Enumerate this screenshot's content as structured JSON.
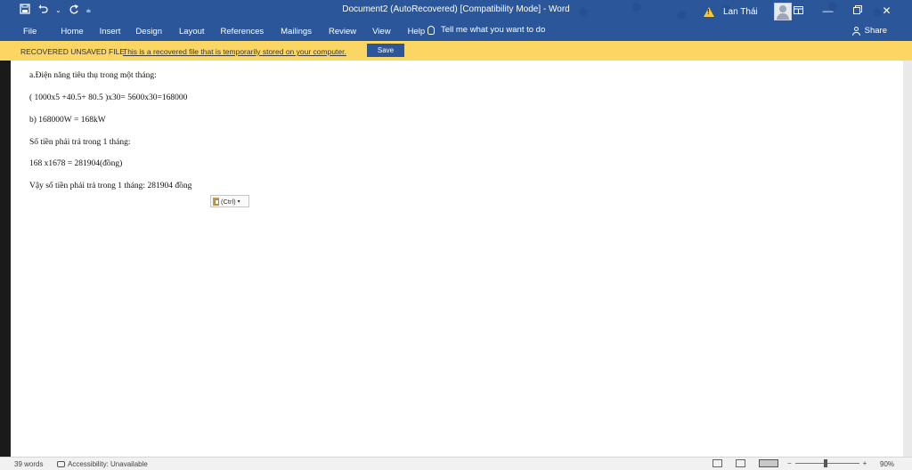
{
  "window": {
    "title": "Document2 (AutoRecovered) [Compatibility Mode] - Word",
    "user_name": "Lan Thái"
  },
  "quick_access": {
    "save_icon": "save-icon",
    "undo_icon": "undo-icon",
    "redo_icon": "redo-icon",
    "customize_icon": "customize-icon"
  },
  "ribbon": {
    "tabs": [
      "File",
      "Home",
      "Insert",
      "Design",
      "Layout",
      "References",
      "Mailings",
      "Review",
      "View",
      "Help"
    ],
    "tell_me": "Tell me what you want to do",
    "share": "Share"
  },
  "infobar": {
    "label": "RECOVERED UNSAVED FILE",
    "message": "This is a recovered file that is temporarily stored on your computer.",
    "save_label": "Save"
  },
  "document": {
    "paragraphs": [
      "a.Điện năng tiêu thụ trong một tháng:",
      "( 1000x5 +40.5+ 80.5 )x30= 5600x30=168000",
      "b) 168000W = 168kW",
      "Số tiền phải trả trong 1 tháng:",
      "168 x1678 = 281904(đồng)",
      "Vậy số tiền phải trả trong 1 tháng: 281904 đồng"
    ],
    "paste_options": "(Ctrl)"
  },
  "status": {
    "words": "39 words",
    "accessibility": "Accessibility: Unavailable",
    "zoom": "90%"
  },
  "colors": {
    "titlebar": "#2b579a",
    "infobar": "#fcd663",
    "save_button": "#2b579a"
  }
}
